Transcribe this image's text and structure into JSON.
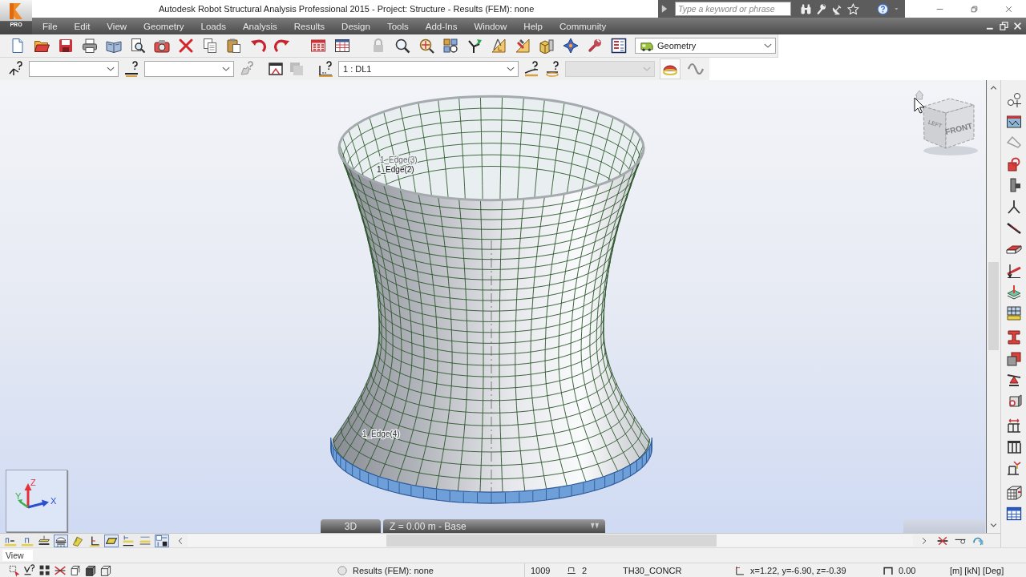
{
  "window": {
    "title": "Autodesk Robot Structural Analysis Professional 2015 - Project: Structure - Results (FEM): none",
    "logo_label": "PRO"
  },
  "help_search": {
    "placeholder": "Type a keyword or phrase"
  },
  "menu": [
    "File",
    "Edit",
    "View",
    "Geometry",
    "Loads",
    "Analysis",
    "Results",
    "Design",
    "Tools",
    "Add-Ins",
    "Window",
    "Help",
    "Community"
  ],
  "standard_toolbar": {
    "layout": "Geometry"
  },
  "selection_toolbar": {
    "dropdowns": [
      {
        "disabled": false
      },
      {
        "disabled": false
      },
      {
        "value": "1 : DL1",
        "disabled": false
      },
      {
        "disabled": true
      }
    ],
    "toggles": [
      {
        "on": true
      },
      {
        "on": false
      }
    ]
  },
  "viewport": {
    "labels": [
      "1_Edge(3)",
      "1_Edge(2)",
      "1_Edge(4)"
    ],
    "view_cube": {
      "faces": [
        "FRONT",
        "LEFT"
      ]
    },
    "axes": [
      "Z",
      "Y",
      "X"
    ],
    "view_mode": "3D",
    "level": "Z = 0.00 m - Base"
  },
  "display_bar": {
    "filters": [
      {
        "on": false
      },
      {
        "on": false
      },
      {
        "on": false
      },
      {
        "on": true
      },
      {
        "on": false
      },
      {
        "on": false
      },
      {
        "on": true
      },
      {
        "on": false
      },
      {
        "on": false
      },
      {
        "on": true
      }
    ]
  },
  "command_field": {
    "value": "View"
  },
  "status_bar": {
    "results": "Results (FEM): none",
    "column_2": "1009",
    "column_3": "2",
    "column_4": "TH30_CONCR",
    "coordinates": "x=1.22, y=-6.90, z=-0.39",
    "column_6": "0.00",
    "units": "[m] [kN] [Deg]"
  }
}
